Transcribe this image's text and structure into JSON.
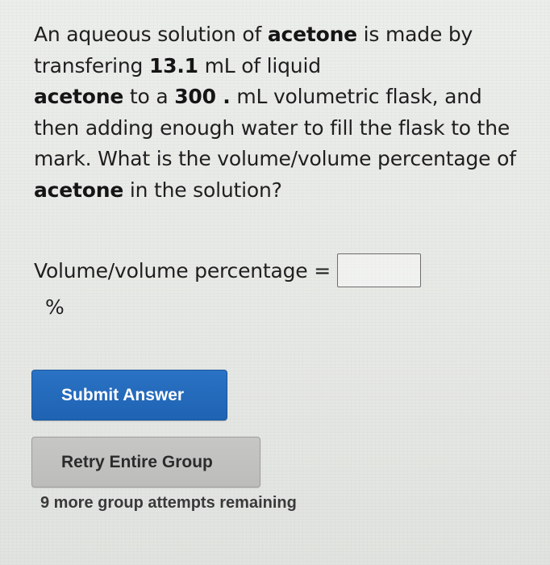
{
  "question": {
    "segments": [
      {
        "text": "An aqueous solution of ",
        "bold": false
      },
      {
        "text": "acetone",
        "bold": true
      },
      {
        "text": " is made by transfering ",
        "bold": false
      },
      {
        "text": "13.1",
        "bold": true
      },
      {
        "text": " mL of liquid ",
        "bold": false
      },
      {
        "text": "acetone",
        "bold": true
      },
      {
        "text": " to a ",
        "bold": false
      },
      {
        "text": "300 .",
        "bold": true
      },
      {
        "text": " mL volumetric flask, and then adding enough water to fill the flask to the mark. What is the volume/volume percentage of ",
        "bold": false
      },
      {
        "text": "acetone",
        "bold": true
      },
      {
        "text": " in the solution?",
        "bold": false
      }
    ]
  },
  "answer": {
    "label": "Volume/volume percentage =",
    "value": "",
    "unit": "%"
  },
  "buttons": {
    "submit_label": "Submit Answer",
    "retry_label": "Retry Entire Group"
  },
  "attempts_text": "9 more group attempts remaining",
  "colors": {
    "submit_bg": "#2a72c4",
    "retry_bg": "#c6c7c5"
  }
}
